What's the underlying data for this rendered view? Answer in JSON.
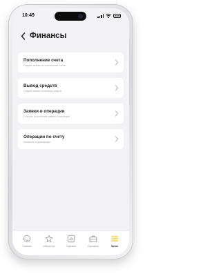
{
  "status_bar": {
    "time": "10:49",
    "battery": "85"
  },
  "header": {
    "title": "Финансы"
  },
  "menu": {
    "items": [
      {
        "title": "Пополнение счета",
        "subtitle": "Подача заявки на пополнение счета"
      },
      {
        "title": "Вывод средств",
        "subtitle": "Подача заявки на вывод средств"
      },
      {
        "title": "Заявки и операции",
        "subtitle": "Статусы исполнения заявок и операций"
      },
      {
        "title": "Операции по счету",
        "subtitle": "Комиссии и дивиденды"
      }
    ]
  },
  "tab_bar": {
    "tabs": [
      {
        "label": "Главная",
        "icon": "home-icon"
      },
      {
        "label": "Избранное",
        "icon": "star-icon"
      },
      {
        "label": "Торговля",
        "icon": "chart-icon"
      },
      {
        "label": "Портфель",
        "icon": "briefcase-icon"
      },
      {
        "label": "Меню",
        "icon": "menu-icon"
      }
    ],
    "active_index": 4
  },
  "colors": {
    "accent": "#f5c518",
    "background": "#f3f3f5",
    "card": "#ffffff"
  }
}
